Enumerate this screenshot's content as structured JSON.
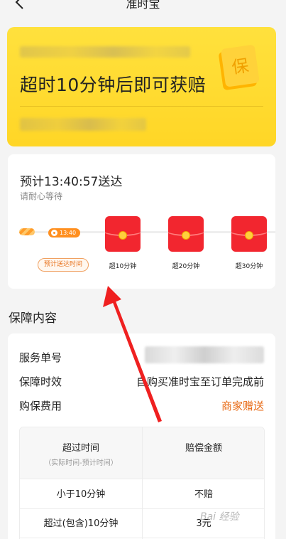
{
  "header": {
    "title": "准时宝"
  },
  "banner": {
    "headline": "超时10分钟后即可获赔",
    "badge_text": "保"
  },
  "delivery": {
    "eta_text": "预计13:40:57送达",
    "wait_text": "请耐心等待",
    "pin_time": "13:40",
    "est_label": "预计送达时间",
    "milestones": [
      "超10分钟",
      "超20分钟",
      "超30分钟"
    ]
  },
  "section": {
    "title": "保障内容"
  },
  "info": {
    "order_label": "服务单号",
    "validity_label": "保障时效",
    "validity_value": "自购买准时宝至订单完成前",
    "fee_label": "购保费用",
    "fee_value": "商家赠送"
  },
  "table": {
    "col1_header": "超过时间",
    "col1_sub": "（实际时间-预计时间）",
    "col2_header": "赔偿金额",
    "rows": [
      {
        "time": "小于10分钟",
        "amount": "不赔"
      },
      {
        "time": "超过(包含)10分钟",
        "amount": "3元"
      }
    ]
  },
  "watermark": "Bai 经验",
  "colors": {
    "banner": "#ffd626",
    "accent": "#e86a14",
    "red_packet": "#f2262f"
  }
}
